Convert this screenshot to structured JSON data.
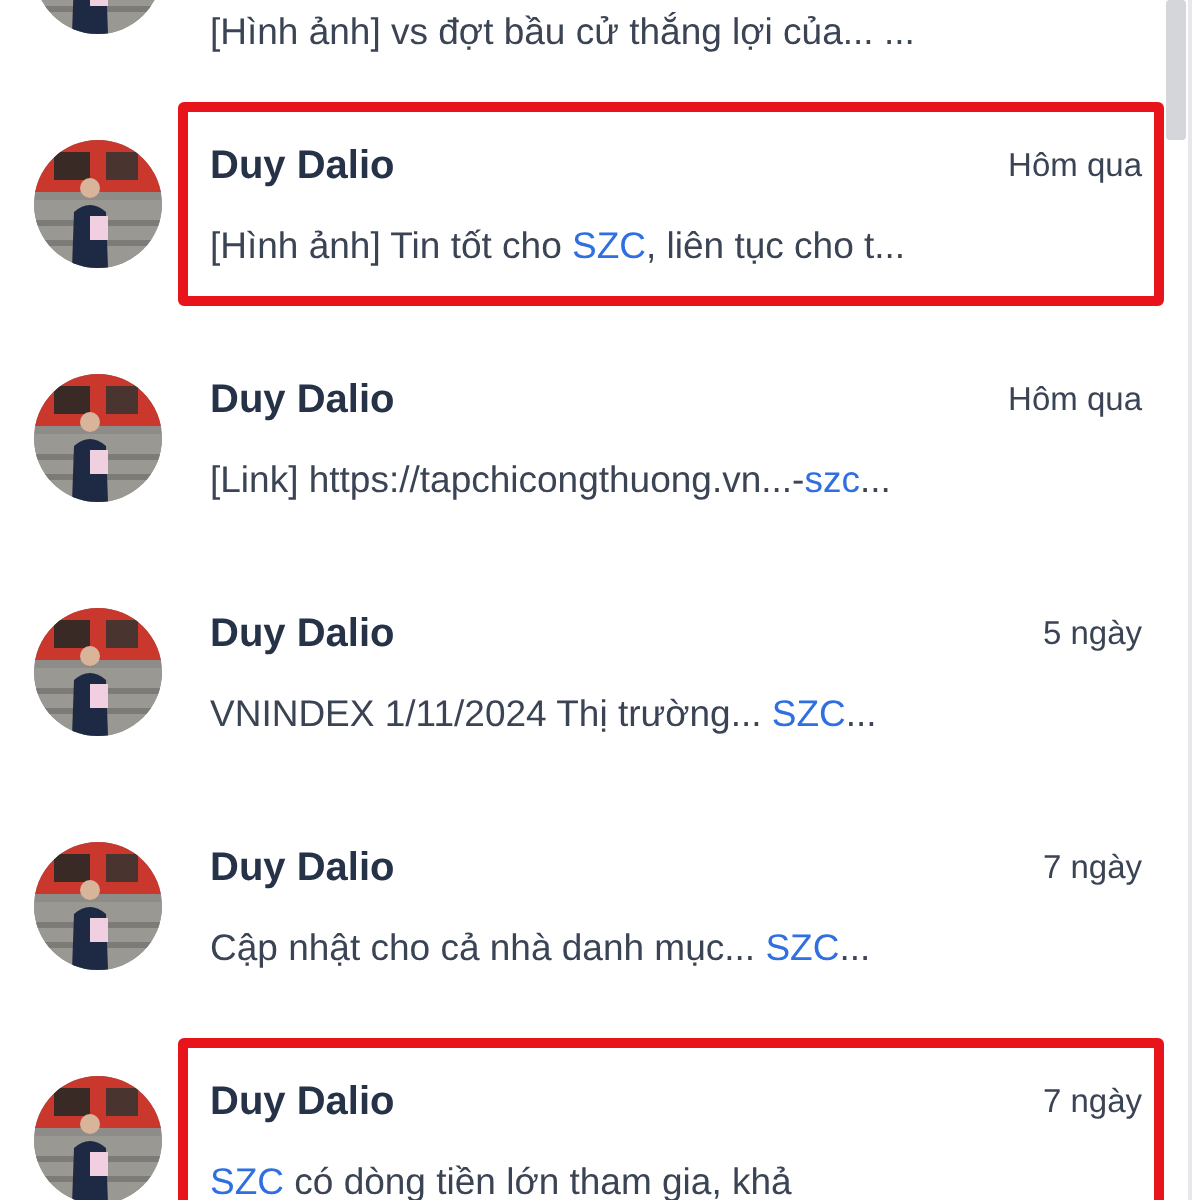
{
  "conversations": [
    {
      "highlighted": false,
      "avatar": {
        "kind": "picture"
      },
      "preview": [
        {
          "text": "[Hình ảnh] vs đợt bầu cử thắng lợi của... ...",
          "kind": "plain"
        }
      ]
    },
    {
      "highlighted": true,
      "avatar": {
        "kind": "picture"
      },
      "name": "Duy Dalio",
      "time": "Hôm qua",
      "preview": [
        {
          "text": "[Hình ảnh] Tin tốt cho ",
          "kind": "plain"
        },
        {
          "text": "SZC",
          "kind": "link"
        },
        {
          "text": ", liên tục cho t...",
          "kind": "plain"
        }
      ]
    },
    {
      "highlighted": false,
      "avatar": {
        "kind": "picture"
      },
      "name": "Duy Dalio",
      "time": "Hôm qua",
      "preview": [
        {
          "text": "[Link] https://tapchicongthuong.vn...-",
          "kind": "plain"
        },
        {
          "text": "szc",
          "kind": "link"
        },
        {
          "text": "...",
          "kind": "plain"
        }
      ]
    },
    {
      "highlighted": false,
      "avatar": {
        "kind": "picture"
      },
      "name": "Duy Dalio",
      "time": "5 ngày",
      "preview": [
        {
          "text": "VNINDEX 1/11/2024 Thị trường... ",
          "kind": "plain"
        },
        {
          "text": "SZC",
          "kind": "link"
        },
        {
          "text": "...",
          "kind": "plain"
        }
      ]
    },
    {
      "highlighted": false,
      "avatar": {
        "kind": "picture"
      },
      "name": "Duy Dalio",
      "time": "7 ngày",
      "preview": [
        {
          "text": "Cập nhật cho cả nhà danh mục... ",
          "kind": "plain"
        },
        {
          "text": "SZC",
          "kind": "link"
        },
        {
          "text": "...",
          "kind": "plain"
        }
      ]
    },
    {
      "highlighted": true,
      "avatar": {
        "kind": "picture"
      },
      "name": "Duy Dalio",
      "time": "7 ngày",
      "preview": [
        {
          "text": "SZC",
          "kind": "link"
        },
        {
          "text": " có dòng tiền lớn tham gia, khả",
          "kind": "plain"
        }
      ]
    }
  ]
}
